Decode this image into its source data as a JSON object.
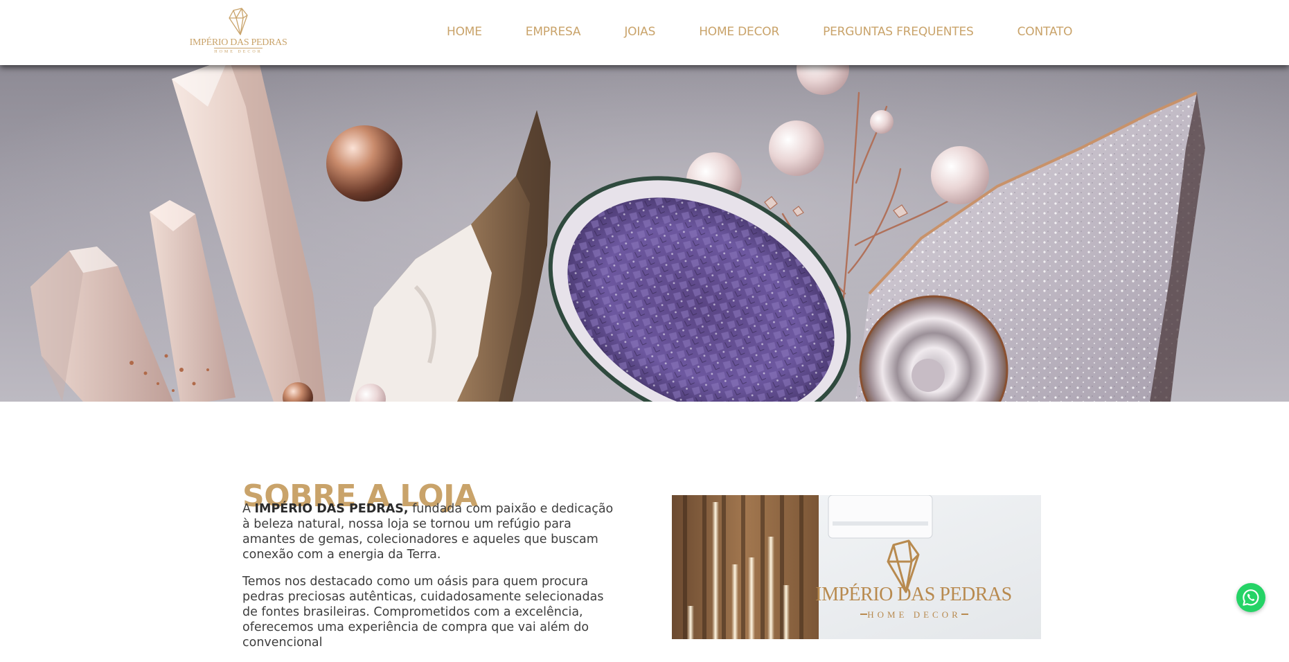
{
  "brand": {
    "name": "IMPÉRIO DAS PEDRAS",
    "tagline": "HOME DECOR",
    "color": "#c9a36a"
  },
  "nav": {
    "items": [
      {
        "label": "HOME"
      },
      {
        "label": "EMPRESA"
      },
      {
        "label": "JOIAS"
      },
      {
        "label": "HOME DECOR"
      },
      {
        "label": "PERGUNTAS FREQUENTES"
      },
      {
        "label": "CONTATO"
      }
    ]
  },
  "hero": {
    "image": "crystals-amethyst-geode-pearls"
  },
  "about": {
    "title": "SOBRE A LOJA",
    "p1_prefix": "A ",
    "p1_brand": "IMPÉRIO DAS PEDRAS,",
    "p1_text": " fundada com paixão e dedicação à beleza natural, nossa loja se tornou um refúgio para amantes de gemas, colecionadores e aqueles que buscam conexão com a energia da Terra.",
    "p2_text": "Temos nos destacado como um oásis para quem procura pedras preciosas autênticas, cuidadosamente selecionadas de fontes brasileiras. Comprometidos com a excelência, oferecemos uma experiência de compra que vai além do convencional"
  },
  "store_photo": {
    "sign_name": "IMPÉRIO DAS PEDRAS",
    "sign_sub": "HOME DECOR"
  },
  "whatsapp": {
    "icon": "whatsapp-icon",
    "color": "#25d366"
  }
}
